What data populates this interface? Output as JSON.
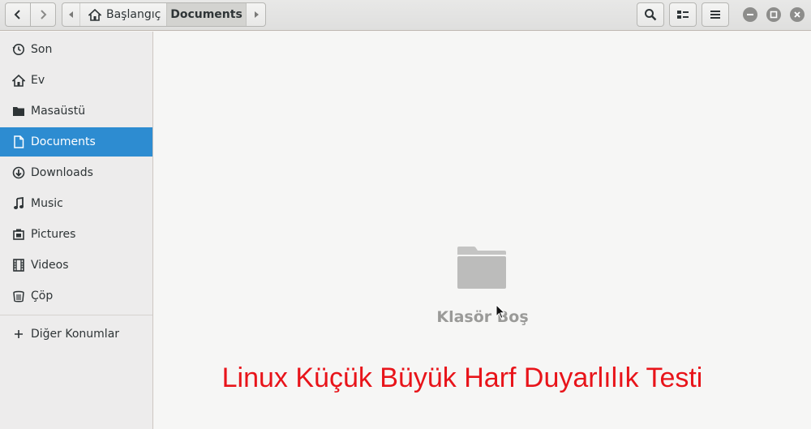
{
  "header": {
    "breadcrumb": {
      "home_label": "Başlangıç",
      "current_label": "Documents"
    },
    "icons": {
      "back": "chevron-left-icon",
      "forward": "chevron-right-icon",
      "search": "search-icon",
      "view": "list-view-icon",
      "menu": "hamburger-menu-icon"
    }
  },
  "sidebar": {
    "items": [
      {
        "label": "Son",
        "icon": "clock-icon"
      },
      {
        "label": "Ev",
        "icon": "home-icon"
      },
      {
        "label": "Masaüstü",
        "icon": "folder-icon"
      },
      {
        "label": "Documents",
        "icon": "document-icon",
        "active": true
      },
      {
        "label": "Downloads",
        "icon": "download-icon"
      },
      {
        "label": "Music",
        "icon": "music-icon"
      },
      {
        "label": "Pictures",
        "icon": "pictures-icon"
      },
      {
        "label": "Videos",
        "icon": "film-icon"
      },
      {
        "label": "Çöp",
        "icon": "trash-icon"
      }
    ],
    "other_locations": {
      "label": "Diğer Konumlar",
      "icon": "plus-icon"
    }
  },
  "main": {
    "empty_label": "Klasör Boş",
    "overlay_title": "Linux Küçük Büyük Harf Duyarlılık Testi"
  },
  "colors": {
    "accent": "#2d8cd1",
    "overlay_text": "#e8141a",
    "empty_icon": "#bcbcbb"
  }
}
